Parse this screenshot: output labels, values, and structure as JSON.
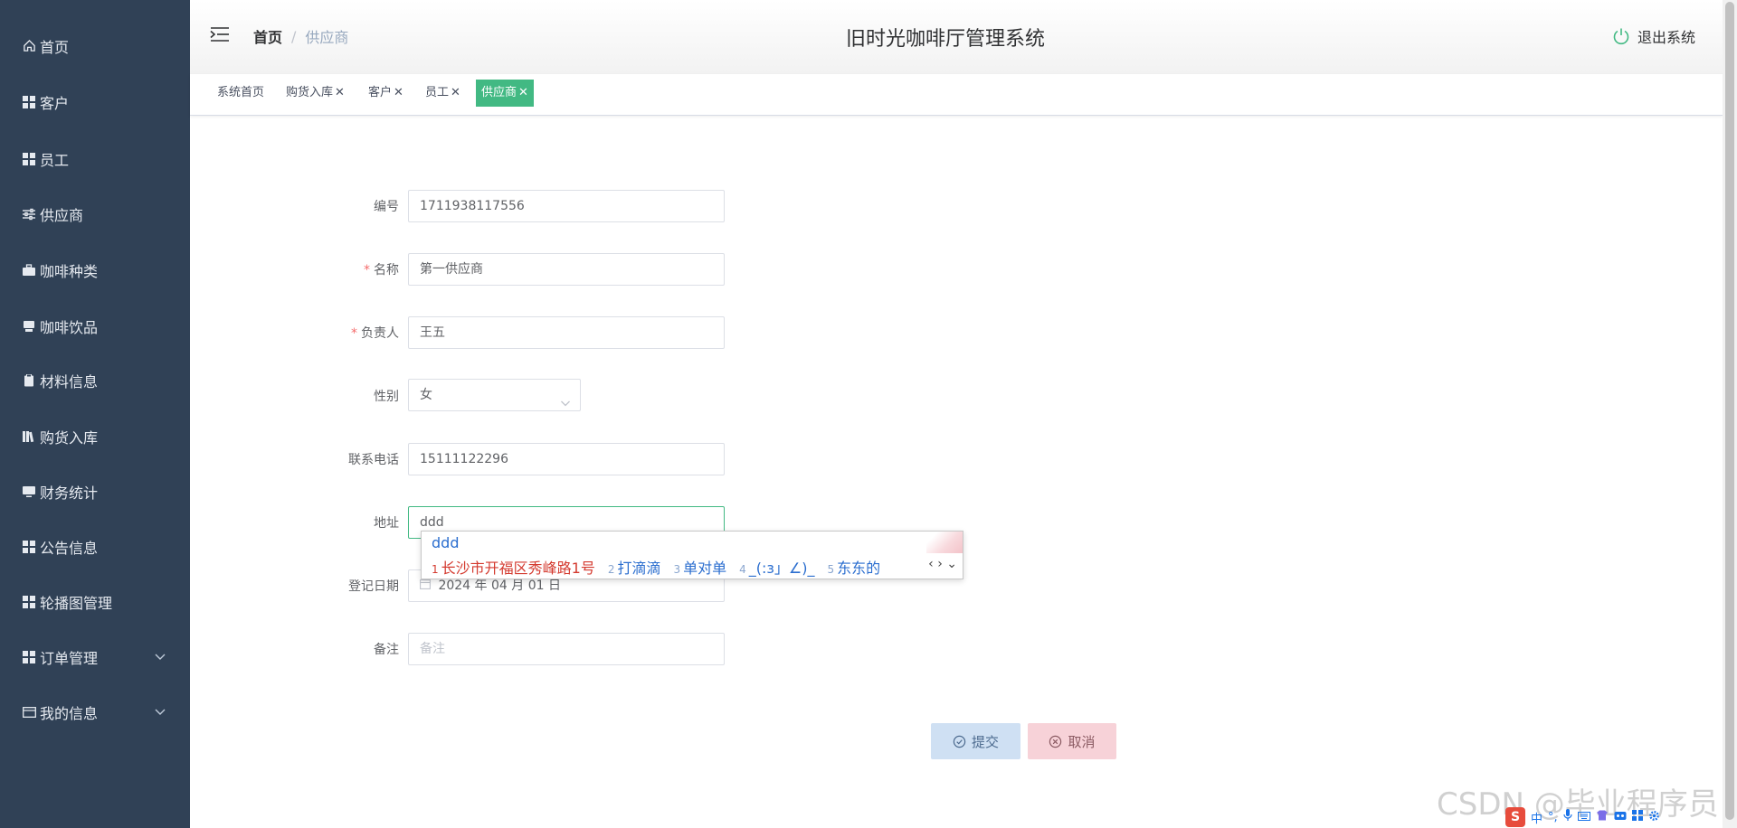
{
  "app": {
    "title": "旧时光咖啡厅管理系统",
    "logout_label": "退出系统"
  },
  "breadcrumb": {
    "home": "首页",
    "separator": "/",
    "current": "供应商"
  },
  "sidebar": {
    "items": [
      {
        "label": "首页",
        "icon": "home-icon"
      },
      {
        "label": "客户",
        "icon": "grid-icon"
      },
      {
        "label": "员工",
        "icon": "grid-icon"
      },
      {
        "label": "供应商",
        "icon": "sliders-icon"
      },
      {
        "label": "咖啡种类",
        "icon": "briefcase-icon"
      },
      {
        "label": "咖啡饮品",
        "icon": "printer-icon"
      },
      {
        "label": "材料信息",
        "icon": "clipboard-icon"
      },
      {
        "label": "购货入库",
        "icon": "books-icon"
      },
      {
        "label": "财务统计",
        "icon": "monitor-icon"
      },
      {
        "label": "公告信息",
        "icon": "grid-icon"
      },
      {
        "label": "轮播图管理",
        "icon": "grid-icon"
      },
      {
        "label": "订单管理",
        "icon": "grid-icon",
        "expandable": true
      },
      {
        "label": "我的信息",
        "icon": "id-card-icon",
        "expandable": true
      }
    ]
  },
  "tags": [
    {
      "label": "系统首页",
      "closable": false,
      "active": false
    },
    {
      "label": "购货入库",
      "closable": true,
      "active": false
    },
    {
      "label": "客户",
      "closable": true,
      "active": false
    },
    {
      "label": "员工",
      "closable": true,
      "active": false
    },
    {
      "label": "供应商",
      "closable": true,
      "active": true
    }
  ],
  "tag_close_glyph": "✕",
  "form": {
    "code": {
      "label": "编号",
      "value": "1711938117556"
    },
    "name": {
      "label": "名称",
      "value": "第一供应商",
      "required": true
    },
    "manager": {
      "label": "负责人",
      "value": "王五",
      "required": true
    },
    "gender": {
      "label": "性别",
      "value": "女"
    },
    "phone": {
      "label": "联系电话",
      "value": "15111122296"
    },
    "address": {
      "label": "地址",
      "value": "ddd"
    },
    "date": {
      "label": "登记日期",
      "value": "2024 年 04 月 01 日"
    },
    "note": {
      "label": "备注",
      "placeholder": "备注"
    },
    "required_mark": "*"
  },
  "ime": {
    "input": "ddd",
    "candidates": [
      {
        "num": "1",
        "text": "长沙市开福区秀峰路1号"
      },
      {
        "num": "2",
        "text": "打滴滴"
      },
      {
        "num": "3",
        "text": "单对单"
      },
      {
        "num": "4",
        "text": "_(:з」∠)_"
      },
      {
        "num": "5",
        "text": "东东的"
      }
    ],
    "nav": "‹ › ⌄"
  },
  "buttons": {
    "submit": "提交",
    "cancel": "取消"
  },
  "watermark": "CSDN @毕业程序员",
  "tray": {
    "ime_mode": "中",
    "punct": "°,"
  },
  "colors": {
    "sidebar_bg": "#304156",
    "active_tag": "#42b983",
    "required": "#f56c6c"
  }
}
